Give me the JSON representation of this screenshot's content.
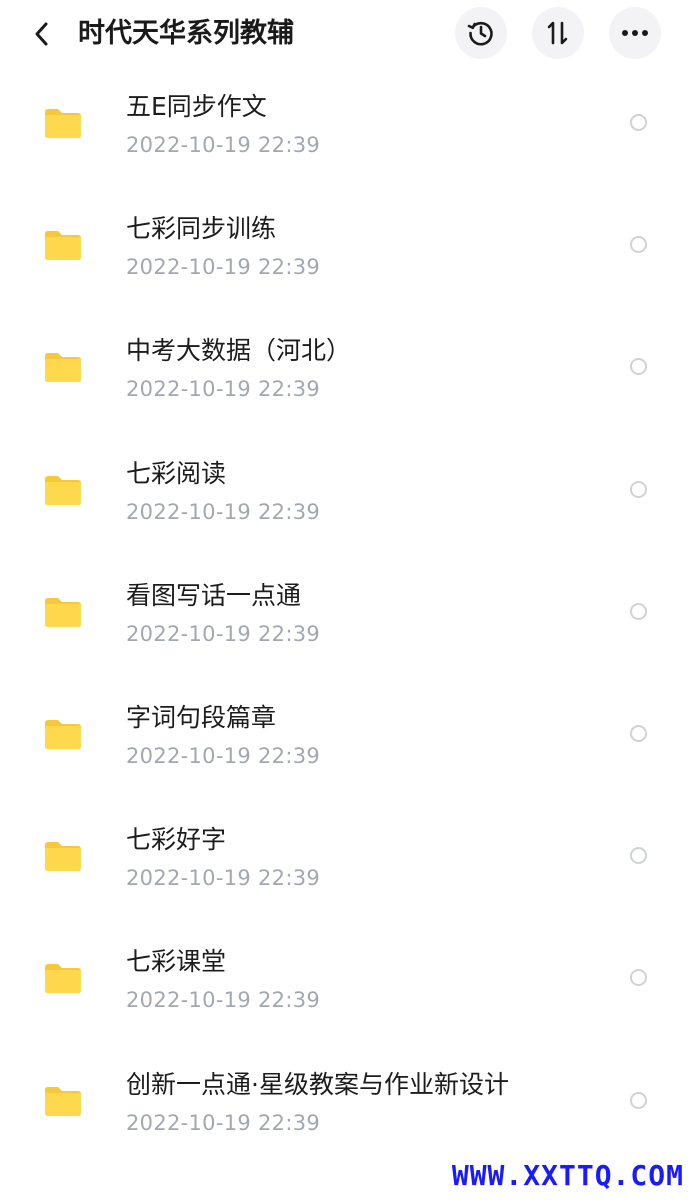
{
  "header": {
    "title": "时代天华系列教辅",
    "back_icon": "chevron-left-icon",
    "history_icon": "history-clock-icon",
    "sort_icon": "sort-arrows-icon",
    "more_icon": "more-dots-icon"
  },
  "colors": {
    "folder": "#FFD84D",
    "folder_dark": "#F7C93A",
    "date_text": "#A3A8B0",
    "watermark": "#1A1AFF"
  },
  "files": [
    {
      "name": "五E同步作文",
      "date": "2022-10-19  22:39"
    },
    {
      "name": "七彩同步训练",
      "date": "2022-10-19  22:39"
    },
    {
      "name": "中考大数据（河北）",
      "date": "2022-10-19  22:39"
    },
    {
      "name": "七彩阅读",
      "date": "2022-10-19  22:39"
    },
    {
      "name": "看图写话一点通",
      "date": "2022-10-19  22:39"
    },
    {
      "name": "字词句段篇章",
      "date": "2022-10-19  22:39"
    },
    {
      "name": "七彩好字",
      "date": "2022-10-19  22:39"
    },
    {
      "name": "七彩课堂",
      "date": "2022-10-19  22:39"
    },
    {
      "name": "创新一点通·星级教案与作业新设计",
      "date": "2022-10-19  22:39"
    }
  ],
  "watermark": "WWW.XXTTQ.COM"
}
